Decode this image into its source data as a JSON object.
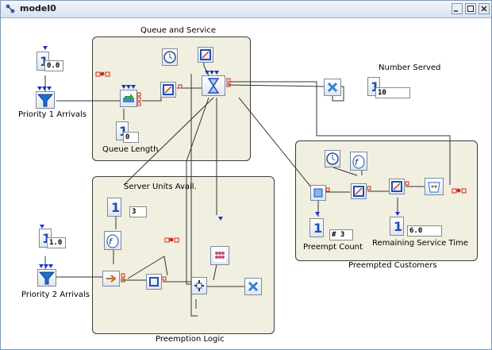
{
  "window": {
    "title": "model0"
  },
  "groups": {
    "queue_service": "Queue and Service",
    "preemption_logic": "Preemption Logic",
    "preempted_customers": "Preempted Customers"
  },
  "labels": {
    "priority1": "Priority 1 Arrivals",
    "priority2": "Priority 2 Arrivals",
    "queue_length": "Queue Length",
    "server_units": "Server Units Avail.",
    "number_served": "Number Served",
    "preempt_count": "Preempt Count",
    "remaining_service": "Remaining Service Time"
  },
  "values": {
    "priority1_const": "0.0",
    "priority2_const": "1.0",
    "queue_length": "0",
    "server_units": "3",
    "number_served": "10",
    "preempt_count": "# 3",
    "remaining_service": "6.0"
  },
  "colors": {
    "group_fill": "#f1efdf",
    "port_input": "#1a33cc",
    "port_output": "#cc2a1a",
    "title_gradient_top": "#f4f7fb",
    "title_gradient_bottom": "#d7e2ef"
  },
  "icons": [
    "model-window-icon",
    "funnel-icon",
    "constant-one-icon",
    "clock-icon",
    "activity-icon",
    "hourglass-icon",
    "multiply-icon",
    "function-icon",
    "gate-icon",
    "queue-icon",
    "exit-icon"
  ]
}
